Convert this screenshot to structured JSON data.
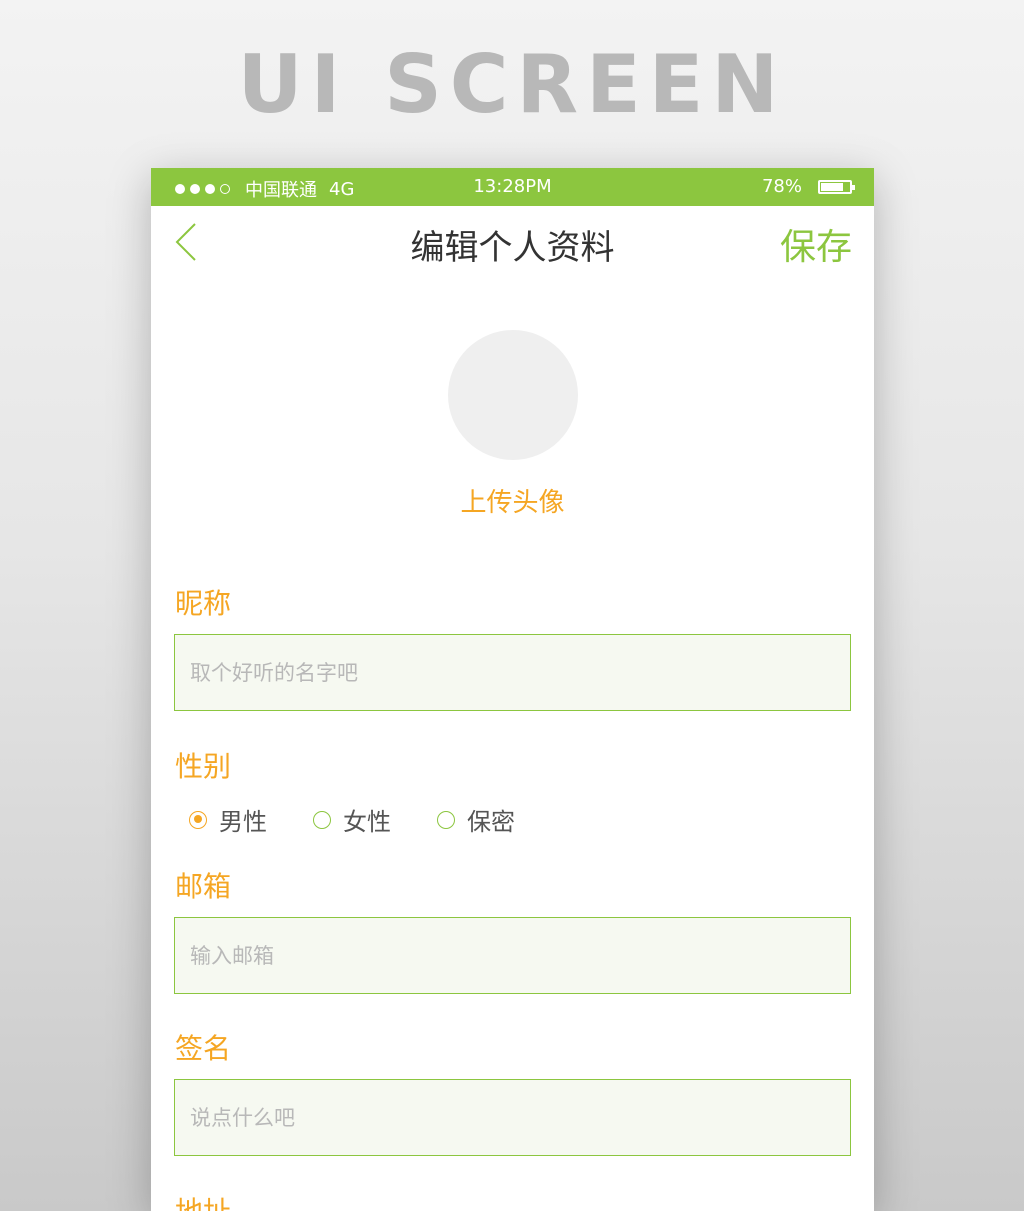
{
  "heading": "UI SCREEN",
  "status_bar": {
    "carrier": "中国联通",
    "network": "4G",
    "time": "13:28PM",
    "battery_text": "78%",
    "battery_level": 0.78,
    "signal_dots_filled": 3,
    "signal_dots_total": 4
  },
  "nav": {
    "back_icon": "chevron-left-icon",
    "title": "编辑个人资料",
    "save_label": "保存"
  },
  "avatar": {
    "upload_label": "上传头像"
  },
  "form": {
    "nickname": {
      "label": "昵称",
      "value": "",
      "placeholder": "取个好听的名字吧"
    },
    "gender": {
      "label": "性别",
      "options": [
        "男性",
        "女性",
        "保密"
      ],
      "selected": "男性"
    },
    "email": {
      "label": "邮箱",
      "value": "",
      "placeholder": "输入邮箱"
    },
    "signature": {
      "label": "签名",
      "value": "",
      "placeholder": "说点什么吧"
    },
    "address": {
      "label": "地址"
    }
  },
  "colors": {
    "accent": "#8cc63f",
    "label": "#f5a623",
    "input_bg": "#f6f9f1",
    "avatar_bg": "#efefef"
  }
}
